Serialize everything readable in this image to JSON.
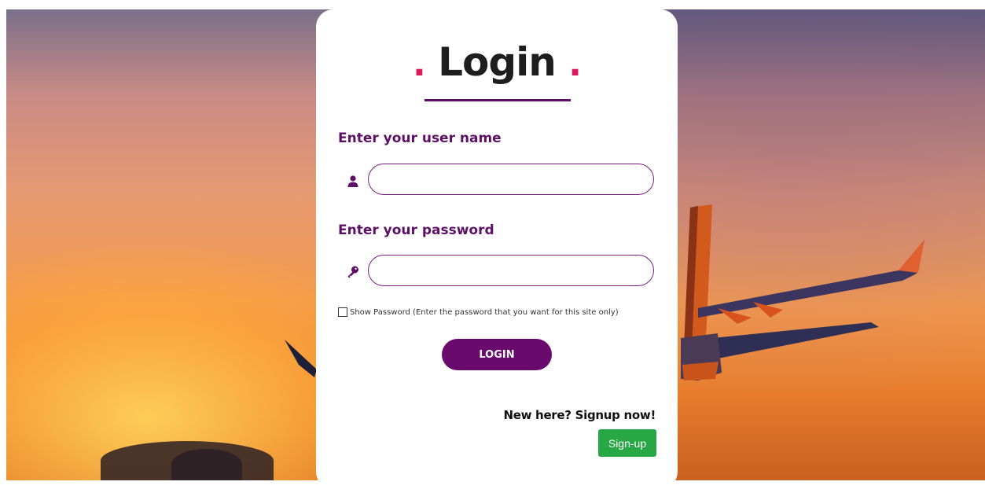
{
  "login_form": {
    "title": "Login",
    "title_dot": ".",
    "username_label": "Enter your user name",
    "username_value": "",
    "username_icon": "user-icon",
    "password_label": "Enter your password",
    "password_value": "",
    "password_icon": "key-icon",
    "show_password_label": "Show Password (Enter the password that you want for this site only)",
    "show_password_checked": false,
    "login_button": "LOGIN",
    "signup_prompt": "New here? Signup now!",
    "signup_button": "Sign-up"
  },
  "colors": {
    "accent_purple": "#6a0a6e",
    "dot_pink": "#e0185e",
    "signup_green": "#28a745"
  }
}
